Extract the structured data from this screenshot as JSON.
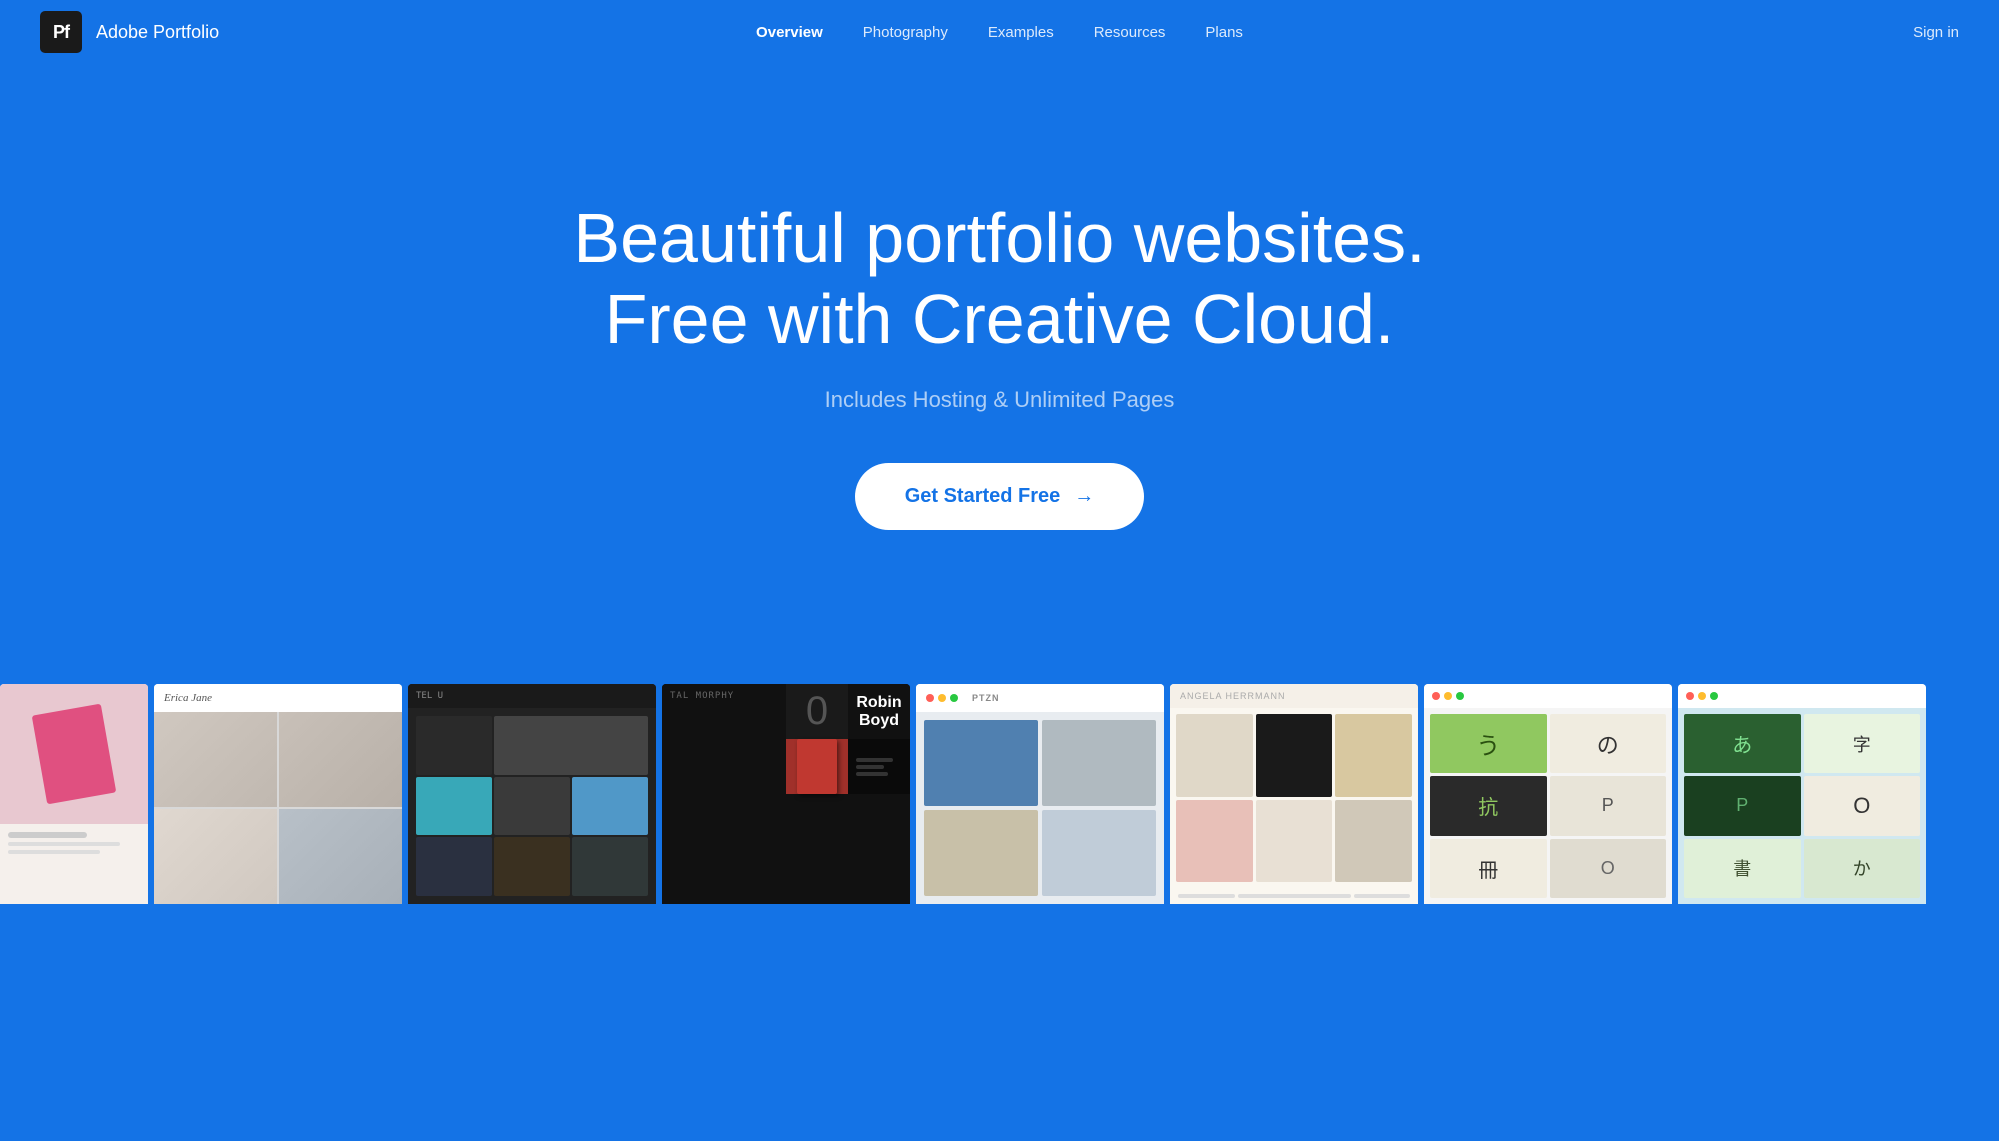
{
  "brand": {
    "logo_text": "Pf",
    "name": "Adobe Portfolio"
  },
  "nav": {
    "links": [
      {
        "label": "Overview",
        "active": true
      },
      {
        "label": "Photography",
        "active": false
      },
      {
        "label": "Examples",
        "active": false
      },
      {
        "label": "Resources",
        "active": false
      },
      {
        "label": "Plans",
        "active": false
      }
    ],
    "signin": "Sign in"
  },
  "hero": {
    "title_line1": "Beautiful portfolio websites.",
    "title_line2": "Free with Creative Cloud.",
    "subtitle": "Includes Hosting & Unlimited Pages",
    "cta_label": "Get Started Free",
    "cta_arrow": "→"
  },
  "colors": {
    "primary_blue": "#1473e6",
    "nav_bg": "transparent",
    "hero_bg": "#1473e6",
    "cta_bg": "white",
    "cta_text": "#1473e6"
  }
}
